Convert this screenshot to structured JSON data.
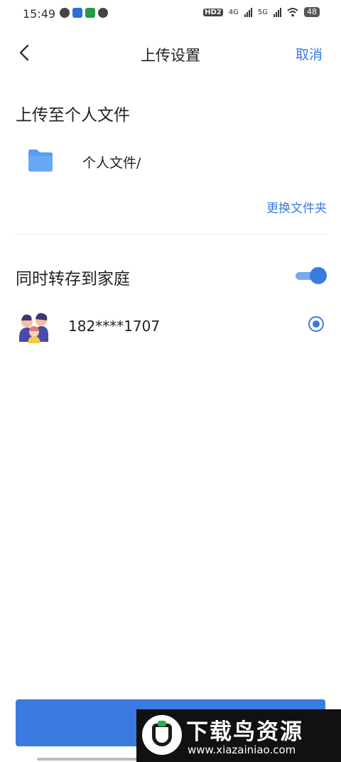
{
  "status_bar": {
    "time": "15:49",
    "network_labels": [
      "HD2",
      "4G",
      "5G"
    ],
    "battery": "48"
  },
  "header": {
    "title": "上传设置",
    "cancel_label": "取消"
  },
  "upload_target": {
    "section_title": "上传至个人文件",
    "folder_path": "个人文件/",
    "change_folder_label": "更换文件夹"
  },
  "family": {
    "section_title": "同时转存到家庭",
    "toggle_on": true,
    "member_name": "182****1707",
    "member_selected": true
  },
  "watermark": {
    "title": "下载鸟资源",
    "url": "www.xiazainiao.com"
  },
  "colors": {
    "accent": "#3a7be0",
    "folder": "#5a9cf2",
    "toggle_track": "#7aa9f0"
  }
}
